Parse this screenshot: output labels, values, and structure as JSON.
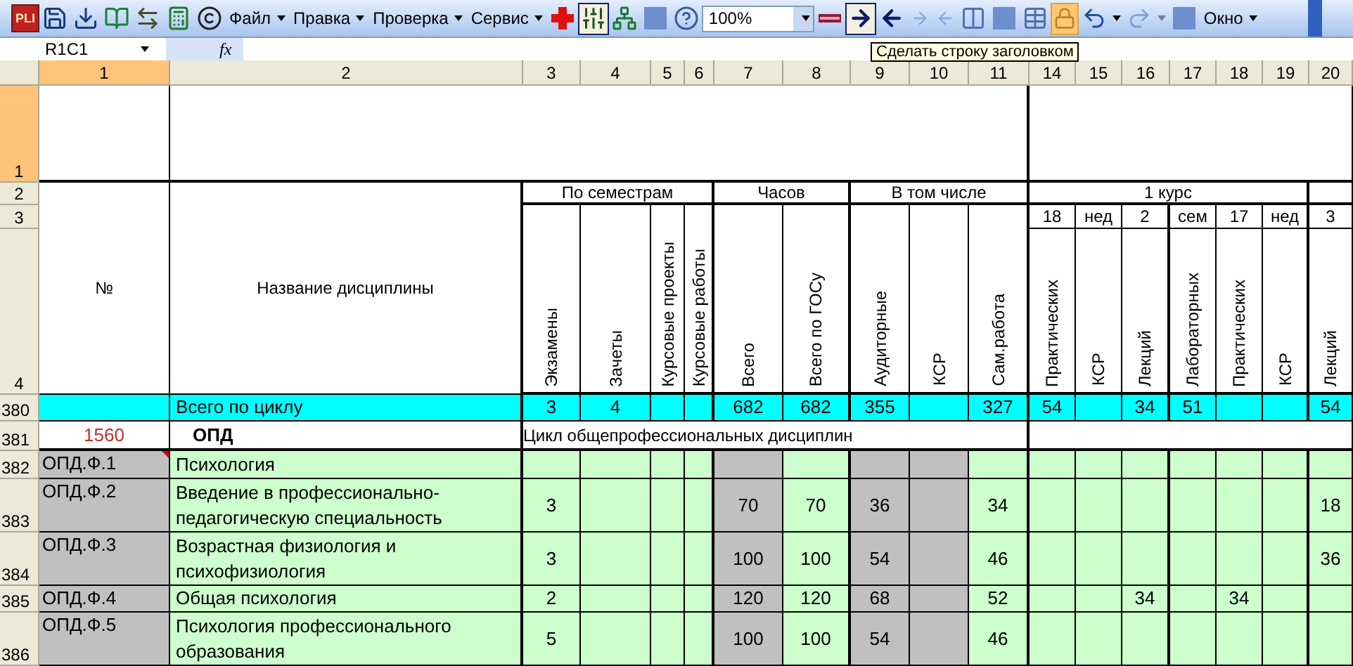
{
  "toolbar": {
    "items": [
      {
        "kind": "logo",
        "text": "PLI"
      },
      {
        "kind": "icon",
        "pressed": false,
        "highlighted": false,
        "disabled": false
      },
      {
        "kind": "icon",
        "pressed": false,
        "highlighted": false,
        "disabled": false
      },
      {
        "kind": "icon",
        "pressed": false,
        "highlighted": false,
        "disabled": false
      },
      {
        "kind": "icon",
        "pressed": false,
        "highlighted": false,
        "disabled": false
      },
      {
        "kind": "icon",
        "pressed": false,
        "highlighted": false,
        "disabled": false
      },
      {
        "kind": "icon",
        "pressed": false,
        "highlighted": false,
        "disabled": false
      },
      {
        "kind": "menu",
        "label": "Файл"
      },
      {
        "kind": "menu",
        "label": "Правка"
      },
      {
        "kind": "menu",
        "label": "Проверка"
      },
      {
        "kind": "menu",
        "label": "Сервис"
      },
      {
        "kind": "icon",
        "pressed": false,
        "highlighted": false,
        "disabled": false
      },
      {
        "kind": "icon",
        "pressed": true,
        "highlighted": false,
        "disabled": false
      },
      {
        "kind": "icon",
        "pressed": false,
        "highlighted": false,
        "disabled": false
      },
      {
        "kind": "icon",
        "pressed": false,
        "highlighted": false,
        "disabled": false
      },
      {
        "kind": "icon",
        "pressed": false,
        "highlighted": false,
        "disabled": false
      },
      {
        "kind": "zoom",
        "value": "100%"
      },
      {
        "kind": "icon",
        "pressed": false,
        "highlighted": false,
        "disabled": false
      },
      {
        "kind": "icon",
        "pressed": true,
        "highlighted": false,
        "disabled": false
      },
      {
        "kind": "icon",
        "pressed": false,
        "highlighted": false,
        "disabled": false
      },
      {
        "kind": "icon",
        "pressed": false,
        "highlighted": false,
        "disabled": true
      },
      {
        "kind": "icon",
        "pressed": false,
        "highlighted": false,
        "disabled": true
      },
      {
        "kind": "icon",
        "pressed": false,
        "highlighted": false,
        "disabled": false
      },
      {
        "kind": "icon",
        "pressed": false,
        "highlighted": false,
        "disabled": false
      },
      {
        "kind": "icon",
        "pressed": false,
        "highlighted": false,
        "disabled": false
      },
      {
        "kind": "icon",
        "pressed": false,
        "highlighted": true,
        "disabled": false
      },
      {
        "kind": "icon",
        "pressed": false,
        "highlighted": false,
        "disabled": false
      },
      {
        "kind": "icon",
        "pressed": false,
        "highlighted": false,
        "disabled": true
      },
      {
        "kind": "icon",
        "pressed": false,
        "highlighted": false,
        "disabled": false
      },
      {
        "kind": "menu",
        "label": "Окно"
      }
    ]
  },
  "formula_bar": {
    "name_box": "R1C1",
    "function_label": "fx"
  },
  "tooltip": "Сделать строку заголовком",
  "column_headers": [
    {
      "label": "1",
      "selected": true
    },
    {
      "label": "2",
      "selected": false
    },
    {
      "label": "3",
      "selected": false
    },
    {
      "label": "4",
      "selected": false
    },
    {
      "label": "5",
      "selected": false
    },
    {
      "label": "6",
      "selected": false
    },
    {
      "label": "7",
      "selected": false
    },
    {
      "label": "8",
      "selected": false
    },
    {
      "label": "9",
      "selected": false
    },
    {
      "label": "10",
      "selected": false
    },
    {
      "label": "11",
      "selected": false
    },
    {
      "label": "14",
      "selected": false
    },
    {
      "label": "15",
      "selected": false
    },
    {
      "label": "16",
      "selected": false
    },
    {
      "label": "17",
      "selected": false
    },
    {
      "label": "18",
      "selected": false
    },
    {
      "label": "19",
      "selected": false
    },
    {
      "label": "20",
      "selected": false
    }
  ],
  "header_rows": [
    {
      "label": "1",
      "selected": true
    },
    {
      "label": "2",
      "selected": false
    },
    {
      "label": "3",
      "selected": false
    },
    {
      "label": "4",
      "selected": false
    }
  ],
  "header": {
    "number_label": "№",
    "name_label": "Название дисциплины",
    "groups": [
      "По семестрам",
      "Часов",
      "В том числе",
      "1 курс"
    ],
    "week_row": [
      "18",
      "нед",
      "2",
      "сем",
      "17",
      "нед",
      "3"
    ],
    "columns": [
      "Экзамены",
      "Зачеты",
      "Курсовые проекты",
      "Курсовые работы",
      "Всего",
      "Всего по ГОСу",
      "Аудиторные",
      "КСР",
      "Сам.работа",
      "Практических",
      "КСР",
      "Лекций",
      "Лабораторных",
      "Практических",
      "КСР",
      "Лекций"
    ]
  },
  "rows": [
    {
      "row_number": "380",
      "kind": "total",
      "name": "Всего по циклу",
      "values": [
        {
          "kind": "value",
          "text": "3"
        },
        {
          "kind": "value",
          "text": "4"
        },
        {
          "kind": "blank"
        },
        {
          "kind": "blank"
        },
        {
          "kind": "value",
          "text": "682"
        },
        {
          "kind": "value",
          "text": "682"
        },
        {
          "kind": "value",
          "text": "355"
        },
        {
          "kind": "blank"
        },
        {
          "kind": "value",
          "text": "327"
        },
        {
          "kind": "value",
          "text": "54"
        },
        {
          "kind": "blank"
        },
        {
          "kind": "value",
          "text": "34"
        },
        {
          "kind": "value",
          "text": "51"
        },
        {
          "kind": "blank"
        },
        {
          "kind": "blank"
        },
        {
          "kind": "value",
          "text": "54"
        }
      ]
    },
    {
      "row_number": "381",
      "kind": "section",
      "code": "1560",
      "name": "ОПД",
      "description": "Цикл общепрофессиональных дисциплин"
    },
    {
      "row_number": "382",
      "kind": "discipline",
      "code": "ОПД.Ф.1",
      "comment": true,
      "name": "Психология",
      "values": [
        {
          "kind": "blank"
        },
        {
          "kind": "blank"
        },
        {
          "kind": "blank"
        },
        {
          "kind": "blank"
        },
        {
          "kind": "blank"
        },
        {
          "kind": "blank"
        },
        {
          "kind": "blank"
        },
        {
          "kind": "blank"
        },
        {
          "kind": "blank"
        },
        {
          "kind": "blank"
        },
        {
          "kind": "blank"
        },
        {
          "kind": "blank"
        },
        {
          "kind": "blank"
        },
        {
          "kind": "blank"
        },
        {
          "kind": "blank"
        },
        {
          "kind": "blank"
        }
      ]
    },
    {
      "row_number": "383",
      "kind": "discipline",
      "code": "ОПД.Ф.2",
      "comment": false,
      "name": "Введение в профессионально-педагогическую специальность",
      "values": [
        {
          "kind": "value",
          "text": "3"
        },
        {
          "kind": "blank"
        },
        {
          "kind": "blank"
        },
        {
          "kind": "blank"
        },
        {
          "kind": "value",
          "text": "70"
        },
        {
          "kind": "value",
          "text": "70"
        },
        {
          "kind": "value",
          "text": "36"
        },
        {
          "kind": "blank"
        },
        {
          "kind": "value",
          "text": "34"
        },
        {
          "kind": "blank"
        },
        {
          "kind": "blank"
        },
        {
          "kind": "blank"
        },
        {
          "kind": "blank"
        },
        {
          "kind": "blank"
        },
        {
          "kind": "blank"
        },
        {
          "kind": "value",
          "text": "18"
        }
      ]
    },
    {
      "row_number": "384",
      "kind": "discipline",
      "code": "ОПД.Ф.3",
      "comment": false,
      "name": "Возрастная физиология и психофизиология",
      "values": [
        {
          "kind": "value",
          "text": "3"
        },
        {
          "kind": "blank"
        },
        {
          "kind": "blank"
        },
        {
          "kind": "blank"
        },
        {
          "kind": "value",
          "text": "100"
        },
        {
          "kind": "value",
          "text": "100"
        },
        {
          "kind": "value",
          "text": "54"
        },
        {
          "kind": "blank"
        },
        {
          "kind": "value",
          "text": "46"
        },
        {
          "kind": "blank"
        },
        {
          "kind": "blank"
        },
        {
          "kind": "blank"
        },
        {
          "kind": "blank"
        },
        {
          "kind": "blank"
        },
        {
          "kind": "blank"
        },
        {
          "kind": "value",
          "text": "36"
        }
      ]
    },
    {
      "row_number": "385",
      "kind": "discipline",
      "code": "ОПД.Ф.4",
      "comment": false,
      "name": "Общая психология",
      "values": [
        {
          "kind": "value",
          "text": "2"
        },
        {
          "kind": "blank"
        },
        {
          "kind": "blank"
        },
        {
          "kind": "blank"
        },
        {
          "kind": "value",
          "text": "120"
        },
        {
          "kind": "value",
          "text": "120"
        },
        {
          "kind": "value",
          "text": "68"
        },
        {
          "kind": "blank"
        },
        {
          "kind": "value",
          "text": "52"
        },
        {
          "kind": "blank"
        },
        {
          "kind": "blank"
        },
        {
          "kind": "value",
          "text": "34"
        },
        {
          "kind": "blank"
        },
        {
          "kind": "value",
          "text": "34"
        },
        {
          "kind": "blank"
        },
        {
          "kind": "blank"
        }
      ]
    },
    {
      "row_number": "386",
      "kind": "discipline",
      "code": "ОПД.Ф.5",
      "comment": false,
      "name": "Психология профессионального образования",
      "values": [
        {
          "kind": "value",
          "text": "5"
        },
        {
          "kind": "blank"
        },
        {
          "kind": "blank"
        },
        {
          "kind": "blank"
        },
        {
          "kind": "value",
          "text": "100"
        },
        {
          "kind": "value",
          "text": "100"
        },
        {
          "kind": "value",
          "text": "54"
        },
        {
          "kind": "blank"
        },
        {
          "kind": "value",
          "text": "46"
        },
        {
          "kind": "blank"
        },
        {
          "kind": "blank"
        },
        {
          "kind": "blank"
        },
        {
          "kind": "blank"
        },
        {
          "kind": "blank"
        },
        {
          "kind": "blank"
        },
        {
          "kind": "blank"
        }
      ]
    }
  ]
}
